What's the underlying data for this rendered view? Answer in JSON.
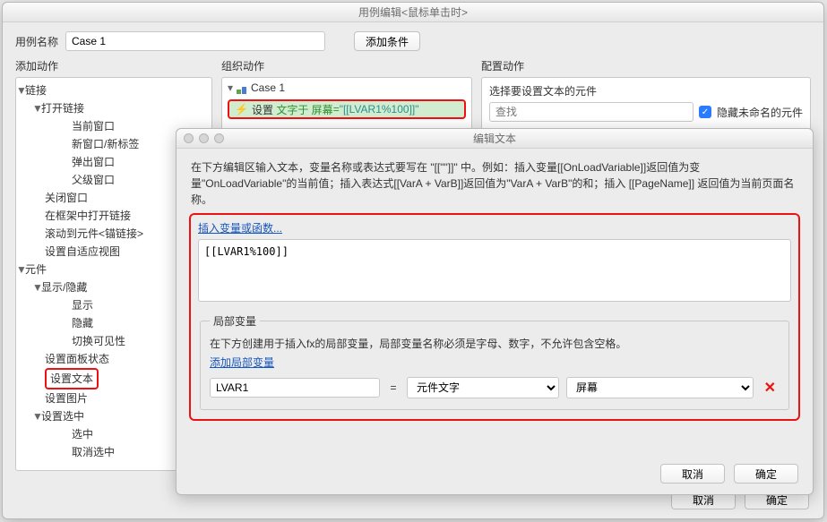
{
  "caseDlg": {
    "title": "用例编辑<鼠标单击时>",
    "caseNameLabel": "用例名称",
    "caseName": "Case 1",
    "addCondBtn": "添加条件",
    "addActionLabel": "添加动作",
    "orgActionLabel": "组织动作",
    "cfgActionLabel": "配置动作",
    "cfgHint": "选择要设置文本的元件",
    "searchPlaceholder": "查找",
    "hideUnnamed": "隐藏未命名的元件",
    "cancel": "取消",
    "ok": "确定"
  },
  "tree": {
    "link": "链接",
    "openLink": "打开链接",
    "curWin": "当前窗口",
    "newWin": "新窗口/新标签",
    "popWin": "弹出窗口",
    "parentWin": "父级窗口",
    "closeWin": "关闭窗口",
    "openInFrame": "在框架中打开链接",
    "scrollTo": "滚动到元件<锚链接>",
    "adaptView": "设置自适应视图",
    "widget": "元件",
    "showHide": "显示/隐藏",
    "show": "显示",
    "hide": "隐藏",
    "toggleVis": "切换可见性",
    "panelState": "设置面板状态",
    "setText": "设置文本",
    "setImage": "设置图片",
    "setSelected": "设置选中",
    "selected": "选中",
    "deselect": "取消选中"
  },
  "orgActions": {
    "caseName": "Case 1",
    "setLabel": "设置",
    "textAt": "文字于",
    "target": "屏幕",
    "eq": " = ",
    "valueQuoted": "\"[[LVAR1%100]]\""
  },
  "editDlg": {
    "title": "编辑文本",
    "desc": "在下方编辑区输入文本，变量名称或表达式要写在 \"[[\"\"]]\" 中。例如：插入变量[[OnLoadVariable]]返回值为变量\"OnLoadVariable\"的当前值；插入表达式[[VarA + VarB]]返回值为\"VarA + VarB\"的和；插入 [[PageName]] 返回值为当前页面名称。",
    "insertLink": "插入变量或函数...",
    "expr": "[[LVAR1%100]]",
    "localLegend": "局部变量",
    "localHint": "在下方创建用于插入fx的局部变量，局部变量名称必须是字母、数字，不允许包含空格。",
    "addLocal": "添加局部变量",
    "lvName": "LVAR1",
    "lvType": "元件文字",
    "lvTarget": "屏幕",
    "cancel": "取消",
    "ok": "确定"
  }
}
